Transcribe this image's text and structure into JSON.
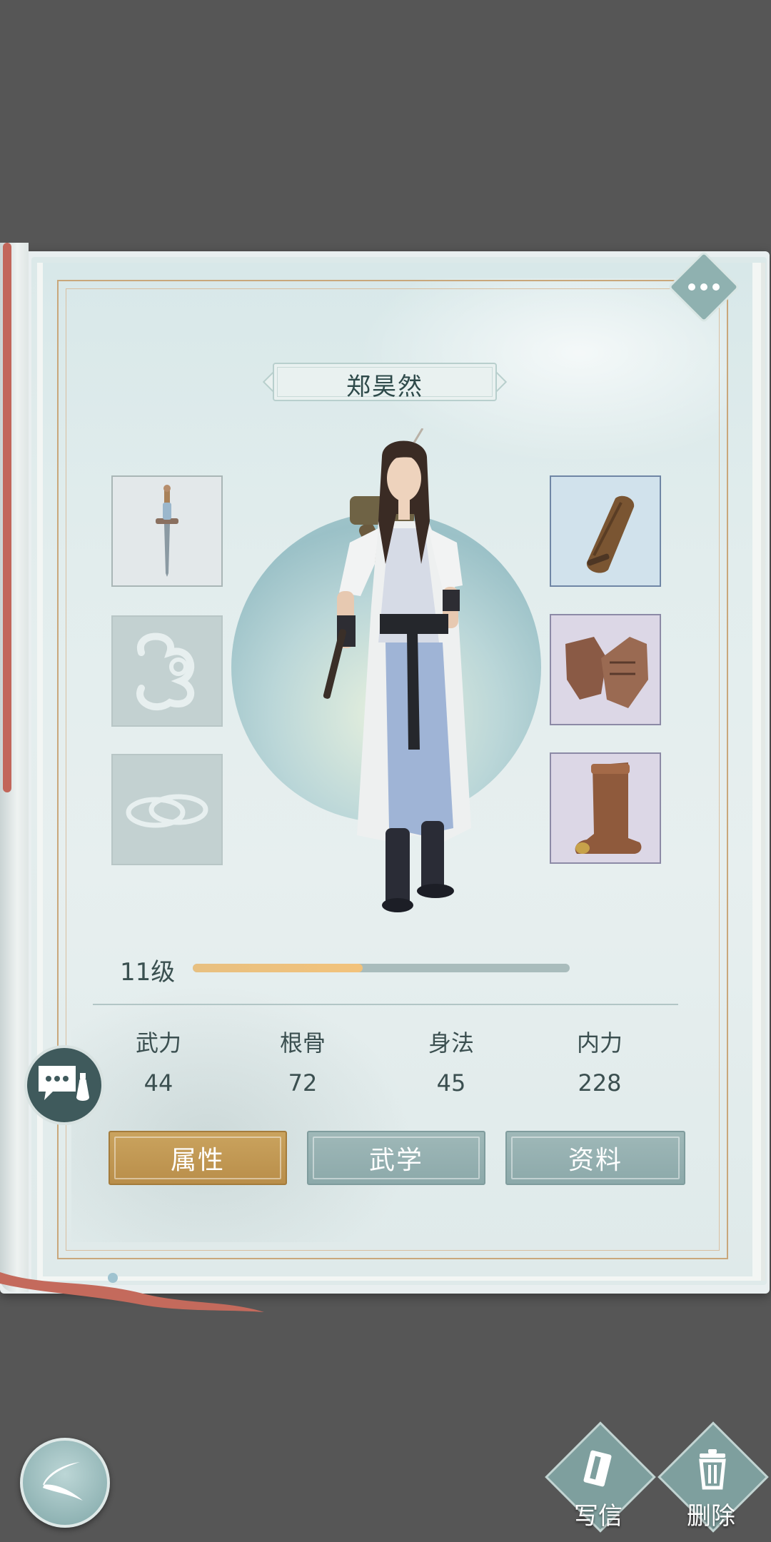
{
  "character": {
    "name": "郑昊然",
    "level_label": "11级",
    "level_progress": 0.45
  },
  "equipment": {
    "left": [
      {
        "name": "sword",
        "icon": "sword-icon",
        "equipped": true
      },
      {
        "name": "accessory",
        "icon": "cloud-icon",
        "equipped": false
      },
      {
        "name": "ring",
        "icon": "rings-icon",
        "equipped": false
      }
    ],
    "right": [
      {
        "name": "bracer",
        "icon": "bracer-icon",
        "equipped": true
      },
      {
        "name": "armor",
        "icon": "armor-icon",
        "equipped": true
      },
      {
        "name": "boots",
        "icon": "boots-icon",
        "equipped": true
      }
    ]
  },
  "stats": [
    {
      "label": "武力",
      "value": "44"
    },
    {
      "label": "根骨",
      "value": "72"
    },
    {
      "label": "身法",
      "value": "45"
    },
    {
      "label": "内力",
      "value": "228"
    }
  ],
  "tabs": [
    {
      "label": "属性",
      "active": true
    },
    {
      "label": "武学",
      "active": false
    },
    {
      "label": "资料",
      "active": false
    }
  ],
  "bottom_actions": {
    "write_label": "写信",
    "delete_label": "删除"
  },
  "colors": {
    "tab_active": "#c59f5a",
    "tab_inactive": "#95b0b0",
    "level_fill": "#f2c27b",
    "frame_gold": "#c9a77b"
  }
}
